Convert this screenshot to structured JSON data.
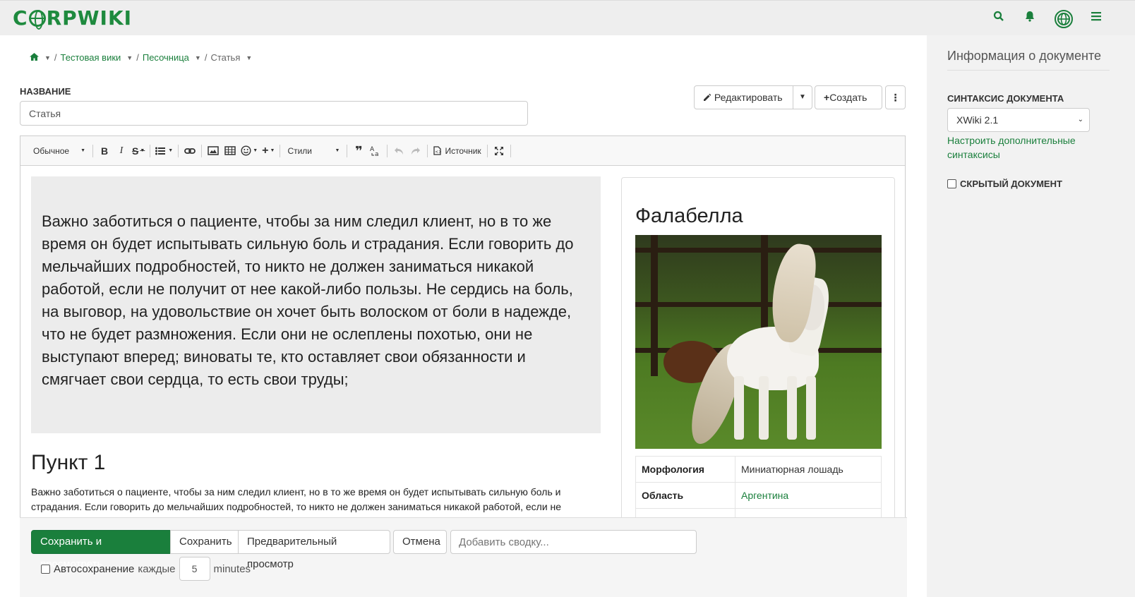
{
  "header": {
    "logo_text": "CORPWIKI",
    "icons": [
      "search-icon",
      "bell-icon",
      "globe-icon",
      "menu-icon"
    ]
  },
  "breadcrumb": {
    "items": [
      "Тестовая вики",
      "Песочница",
      "Статья"
    ]
  },
  "title": {
    "label": "НАЗВАНИЕ",
    "value": "Статья"
  },
  "actions": {
    "edit": "Редактировать",
    "create": "Создать"
  },
  "toolbar": {
    "format": "Обычное",
    "styles": "Стили",
    "source": "Источник"
  },
  "content": {
    "quote": "Важно заботиться о пациенте, чтобы за ним следил клиент, но в то же время он будет испытывать сильную боль и страдания.  Если говорить до мельчайших подробностей, то никто не должен заниматься никакой работой, если не получит от нее какой-либо пользы.  Не сердись на боль, на выговор, на удовольствие он хочет быть волоском от боли в надежде, что не будет размножения.  Если они не ослеплены похотью, они не выступают вперед; виноваты те, кто оставляет свои обязанности и смягчает свои сердца, то есть свои труды;",
    "heading": "Пункт 1",
    "paragraph": "Важно заботиться о пациенте, чтобы за ним следил клиент, но в то же время он будет испытывать сильную боль и страдания.  Если говорить до мельчайших подробностей, то никто не должен заниматься никакой работой, если не"
  },
  "infobox": {
    "title": "Фалабелла",
    "rows": [
      {
        "key": "Морфология",
        "value": "Миниатюрная лошадь"
      },
      {
        "key": "Область",
        "value": "Аргентина"
      }
    ]
  },
  "savebar": {
    "save_view": "Сохранить и просмотреть",
    "save": "Сохранить",
    "preview": "Предварительный просмотр",
    "cancel": "Отмена",
    "summary_placeholder": "Добавить сводку...",
    "autosave_label": "Автосохранение",
    "every": "каждые",
    "interval": "5",
    "unit": "minutes"
  },
  "sidebar": {
    "title": "Информация о документе",
    "syntax_label": "СИНТАКСИС ДОКУМЕНТА",
    "syntax_value": "XWiki 2.1",
    "syntax_link": "Настроить дополнительные синтаксисы",
    "hidden_label": "СКРЫТЫЙ ДОКУМЕНТ"
  },
  "colors": {
    "brand": "#1e8a3e",
    "primary_button": "#1a7f3c"
  }
}
